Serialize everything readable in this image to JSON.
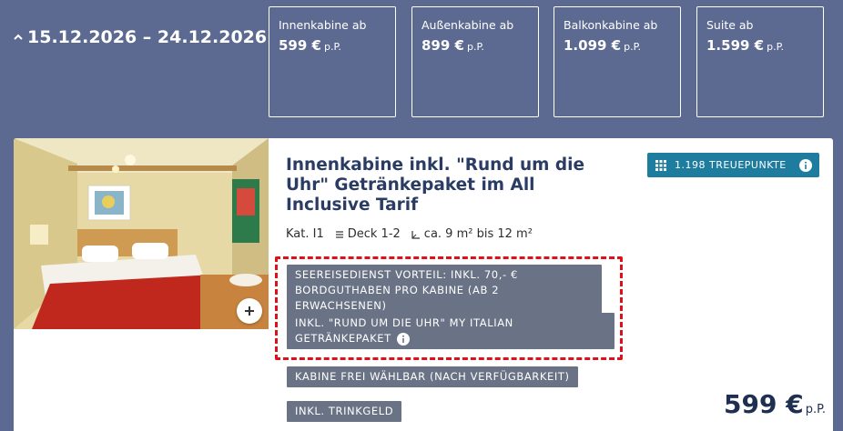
{
  "header": {
    "date_range": "15.12.2026 – 24.12.2026",
    "price_boxes": [
      {
        "label": "Innenkabine ab",
        "price": "599 €",
        "unit": "p.P."
      },
      {
        "label": "Außenkabine ab",
        "price": "899 €",
        "unit": "p.P."
      },
      {
        "label": "Balkonkabine ab",
        "price": "1.099 €",
        "unit": "p.P."
      },
      {
        "label": "Suite ab",
        "price": "1.599 €",
        "unit": "p.P."
      }
    ]
  },
  "cabin": {
    "title": "Innenkabine inkl. \"Rund um die Uhr\" Getränkepaket im All Inclusive Tarif",
    "category": "Kat. I1",
    "deck": "Deck 1-2",
    "size": "ca. 9 m² bis 12 m²",
    "loyalty_points": "1.198 TREUEPUNKTE",
    "tags": [
      "SEEREISEDIENST VORTEIL: INKL. 70,- € BORDGUTHABEN PRO KABINE (AB 2 ERWACHSENEN)",
      "INKL. \"RUND UM DIE UHR\" MY ITALIAN GETRÄNKEPAKET",
      "KABINE FREI WÄHLBAR (NACH VERFÜGBARKEIT)",
      "INKL. TRINKGELD"
    ],
    "price": "599 €",
    "price_unit": "p.P."
  },
  "colors": {
    "background": "#5c6a91",
    "accent": "#1e7c9e",
    "tag_bg": "#6a7285",
    "highlight": "#e0101a",
    "title": "#2a3c64"
  },
  "icons": {
    "date_toggle": "chevron-up-icon",
    "loyalty": "grid-icon",
    "info": "info-icon",
    "zoom": "plus-icon",
    "deck": "list-icon",
    "size": "area-icon"
  }
}
